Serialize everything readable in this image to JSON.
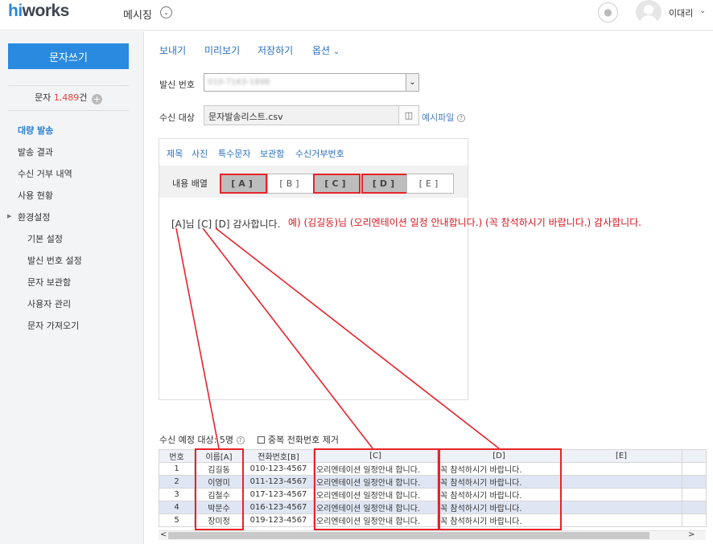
{
  "header": {
    "logo_hi": "hi",
    "logo_rest": "works",
    "app_title": "메시징",
    "user_name": "이대리"
  },
  "sidebar": {
    "compose_label": "문자쓰기",
    "count_prefix": "문자 ",
    "count_value": "1,489",
    "count_suffix": "건",
    "items": [
      {
        "label": "대량 발송"
      },
      {
        "label": "발송 결과"
      },
      {
        "label": "수신 거부 내역"
      },
      {
        "label": "사용 현황"
      },
      {
        "label": "환경설정"
      },
      {
        "label": "기본 설정"
      },
      {
        "label": "발신 번호 설정"
      },
      {
        "label": "문자 보관함"
      },
      {
        "label": "사용자 관리"
      },
      {
        "label": "문자 가져오기"
      }
    ]
  },
  "toolbar": {
    "send": "보내기",
    "preview": "미리보기",
    "save": "저장하기",
    "options": "옵션"
  },
  "form": {
    "sender_label": "발신 번호",
    "sender_value": "010-7163-1898",
    "recipient_label": "수신 대상",
    "recipient_file": "문자발송리스트.csv",
    "sample_file": "예시파일"
  },
  "compose": {
    "tabs": [
      "제목",
      "사진",
      "특수문자",
      "보관함",
      "수신거부번호"
    ],
    "layout_label": "내용 배열",
    "fields": [
      "[A]",
      "[B]",
      "[C]",
      "[D]",
      "[E]"
    ],
    "message_text": "[A]님 [C] [D] 감사합니다."
  },
  "preview_text": "예) (김길동)님 (오리엔테이션 일정 안내합니다.) (꼭 참석하시기 바랍니다.) 감사합니다.",
  "recipients": {
    "label": "수신 예정 대상: 5명",
    "dedupe_label": "중복 전화번호 제거",
    "columns": [
      "번호",
      "이름[A]",
      "전화번호[B]",
      "[C]",
      "[D]",
      "[E]"
    ],
    "rows": [
      [
        "1",
        "김길동",
        "010-123-4567",
        "오리엔테이션 일정안내 합니다.",
        "꼭 참석하시기 바랍니다.",
        ""
      ],
      [
        "2",
        "이영미",
        "011-123-4567",
        "오리엔테이션 일정안내 합니다.",
        "꼭 참석하시기 바랍니다.",
        ""
      ],
      [
        "3",
        "김철수",
        "017-123-4567",
        "오리엔테이션 일정안내 합니다.",
        "꼭 참석하시기 바랍니다.",
        ""
      ],
      [
        "4",
        "박문수",
        "016-123-4567",
        "오리엔테이션 일정안내 합니다.",
        "꼭 참석하시기 바랍니다.",
        ""
      ],
      [
        "5",
        "장미정",
        "019-123-4567",
        "오리엔테이션 일정안내 합니다.",
        "꼭 참석하시기 바랍니다.",
        ""
      ]
    ]
  },
  "colors": {
    "accent": "#2a8ae0",
    "link": "#2a6fbe",
    "highlight": "#e8232a"
  }
}
